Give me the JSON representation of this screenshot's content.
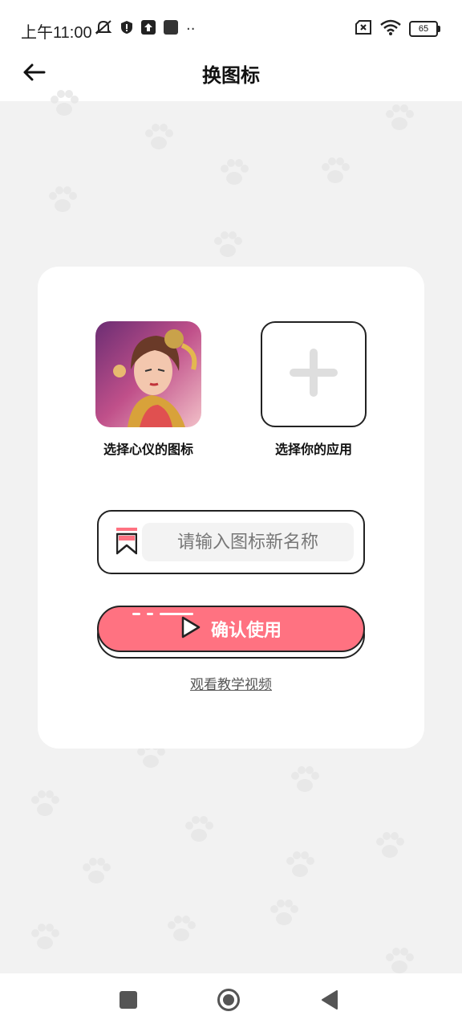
{
  "status_bar": {
    "time": "上午11:00",
    "dots": "··",
    "battery_level": "65",
    "icons": [
      "mute-bell-icon",
      "shield-icon",
      "upload-icon",
      "square-icon",
      "sim-off-icon",
      "wifi-icon",
      "battery-icon"
    ]
  },
  "header": {
    "title": "换图标",
    "back_icon": "arrow-left-icon"
  },
  "main": {
    "chosen_icon_label": "选择心仪的图标",
    "app_slot_label": "选择你的应用",
    "name_input_placeholder": "请输入图标新名称",
    "name_input_value": "",
    "confirm_label": "确认使用",
    "tutorial_link": "观看教学视频",
    "accent_color": "#ff7281"
  },
  "nav_bar": {
    "icons": [
      "recent-apps-icon",
      "home-icon",
      "back-triangle-icon"
    ]
  }
}
